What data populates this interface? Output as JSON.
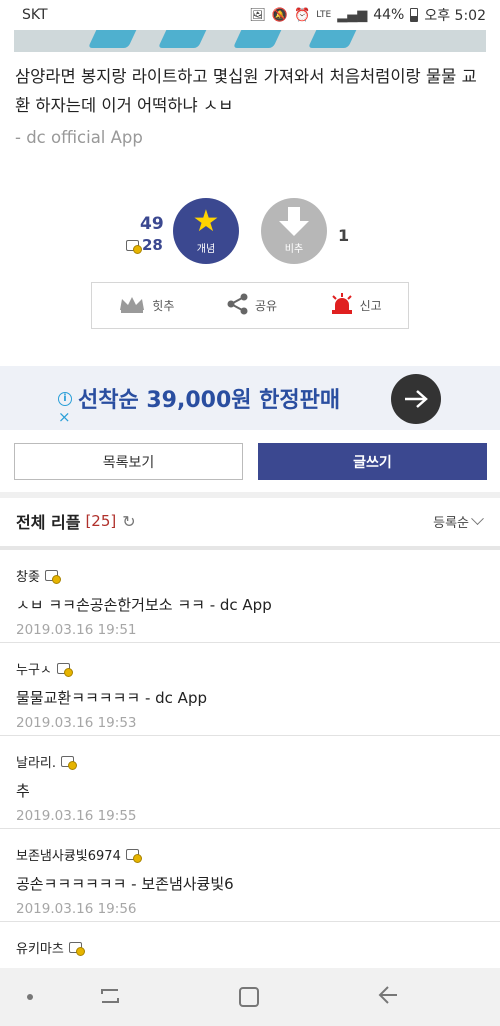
{
  "status_bar": {
    "carrier": "SKT",
    "network": "LTE",
    "battery": "44%",
    "time": "오후 5:02"
  },
  "post": {
    "body": "삼양라면 봉지랑 라이트하고 몇십원 가져와서 처음처럼이랑 물물 교환 하자는데 이거 어떡하냐 ㅅㅂ",
    "signature": "- dc official App"
  },
  "votes": {
    "up_count": "49",
    "fixed_up_count": "28",
    "up_label": "개념",
    "down_label": "비추",
    "down_count": "1"
  },
  "actions": {
    "hit_label": "힛추",
    "share_label": "공유",
    "report_label": "신고"
  },
  "ad": {
    "text": "선착순 39,000원 한정판매",
    "info_icon": "i",
    "close_icon": "×"
  },
  "buttons": {
    "list_label": "목록보기",
    "write_label": "글쓰기"
  },
  "replies": {
    "title": "전체 리플",
    "count": "[25]",
    "refresh_icon": "↻",
    "sort_label": "등록순",
    "items": [
      {
        "name": "창좆",
        "text": "ㅅㅂ ㅋㅋ손공손한거보소 ㅋㅋ - dc App",
        "date": "2019.03.16 19:51"
      },
      {
        "name": "누구ㅅ",
        "text": "물물교환ㅋㅋㅋㅋㅋ - dc App",
        "date": "2019.03.16 19:53"
      },
      {
        "name": "날라리.",
        "text": "추",
        "date": "2019.03.16 19:55"
      },
      {
        "name": "보존냄사큥빛6974",
        "text": "공손ㅋㅋㅋㅋㅋㅋ - 보존냄사큥빛6",
        "date": "2019.03.16 19:56"
      },
      {
        "name": "유키마츠",
        "text": "",
        "date": ""
      }
    ]
  },
  "colors": {
    "brand": "#3b4890",
    "ad_text": "#2a4ea0",
    "reply_count": "#b0302b"
  }
}
